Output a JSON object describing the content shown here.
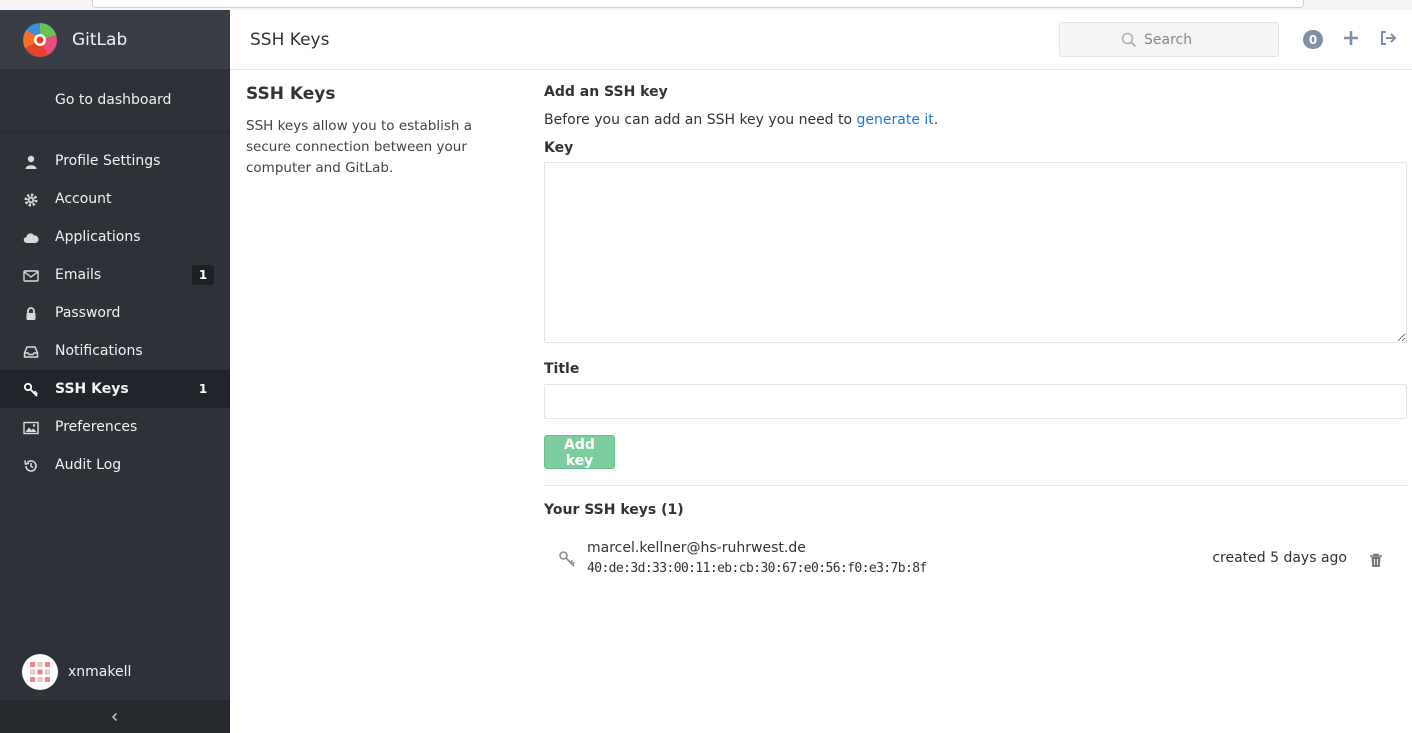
{
  "app": {
    "name": "GitLab"
  },
  "sidebar": {
    "dashboard_label": "Go to dashboard",
    "items": [
      {
        "label": "Profile Settings",
        "icon": "user-icon",
        "badge": ""
      },
      {
        "label": "Account",
        "icon": "gear-icon",
        "badge": ""
      },
      {
        "label": "Applications",
        "icon": "cloud-icon",
        "badge": ""
      },
      {
        "label": "Emails",
        "icon": "envelope-icon",
        "badge": "1"
      },
      {
        "label": "Password",
        "icon": "lock-icon",
        "badge": ""
      },
      {
        "label": "Notifications",
        "icon": "inbox-icon",
        "badge": ""
      },
      {
        "label": "SSH Keys",
        "icon": "key-icon",
        "badge": "1",
        "active": true
      },
      {
        "label": "Preferences",
        "icon": "image-icon",
        "badge": ""
      },
      {
        "label": "Audit Log",
        "icon": "history-icon",
        "badge": ""
      }
    ],
    "user": {
      "name": "xnmakell"
    },
    "collapse_icon": "chevron-left-icon"
  },
  "header": {
    "title": "SSH Keys",
    "search_placeholder": "Search",
    "todos_count": "0",
    "new_icon": "plus-icon",
    "signout_icon": "sign-out-icon"
  },
  "left": {
    "heading": "SSH Keys",
    "description": "SSH keys allow you to establish a secure connection between your computer and GitLab."
  },
  "form": {
    "heading": "Add an SSH key",
    "intro_text": "Before you can add an SSH key you need to ",
    "intro_link": "generate it",
    "intro_end": ".",
    "key_label": "Key",
    "key_value": "",
    "title_label": "Title",
    "title_value": "",
    "submit_label": "Add key"
  },
  "keys": {
    "heading": "Your SSH keys (1)",
    "list": [
      {
        "title": "marcel.kellner@hs-ruhrwest.de",
        "fingerprint": "40:de:3d:33:00:11:eb:cb:30:67:e0:56:f0:e3:7b:8f",
        "created": "created 5 days ago"
      }
    ]
  },
  "colors": {
    "sidebar_bg": "#2e3238",
    "brand_bg": "#393e46",
    "active_bg": "#21242a",
    "link": "#1f78d1",
    "add_button": "#7dcd9f",
    "todos_badge": "#7f8fa4"
  }
}
